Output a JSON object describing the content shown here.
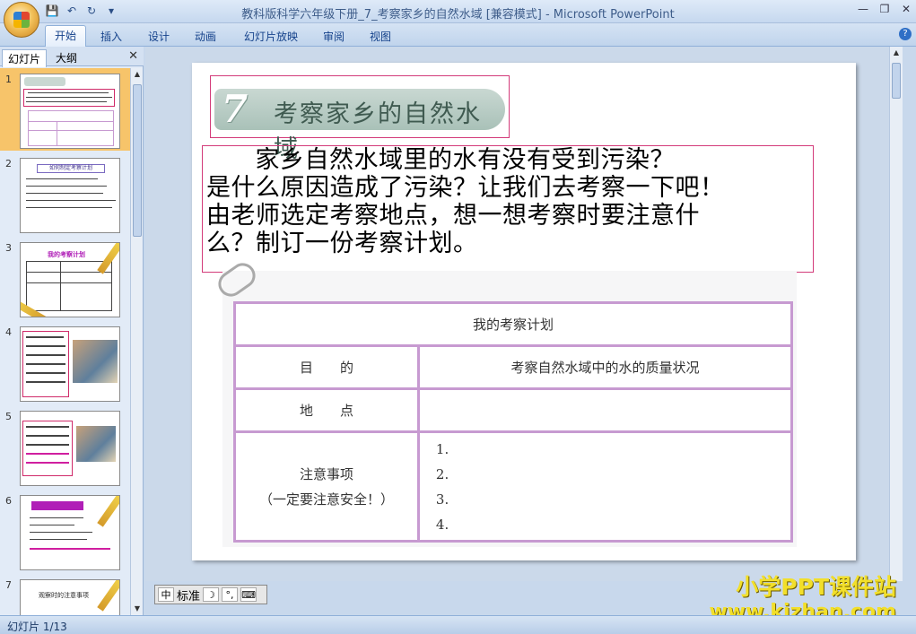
{
  "window": {
    "title": "教科版科学六年级下册_7_考察家乡的自然水域 [兼容模式] - Microsoft PowerPoint",
    "controls": [
      "—",
      "❐",
      "✕"
    ]
  },
  "quick_access": {
    "save_icon": "save-icon",
    "undo_icon": "undo-icon",
    "redo_icon": "redo-icon"
  },
  "ribbon": {
    "tabs": [
      "开始",
      "插入",
      "设计",
      "动画",
      "幻灯片放映",
      "审阅",
      "视图"
    ],
    "active_tab": "开始"
  },
  "left_pane": {
    "tabs": [
      "幻灯片",
      "大纲"
    ],
    "close": "✕",
    "thumbnails": [
      {
        "num": "1"
      },
      {
        "num": "2",
        "title": "如何制定考察计划"
      },
      {
        "num": "3",
        "title": "我的考察计划"
      },
      {
        "num": "4"
      },
      {
        "num": "5"
      },
      {
        "num": "6"
      },
      {
        "num": "7",
        "title": "观察时的注意事项"
      }
    ]
  },
  "slide": {
    "title_number": "7",
    "title": "考察家乡的自然水域",
    "body": "      家乡自然水域里的水有没有受到污染？\n是什么原因造成了污染？让我们去考察一下吧！\n由老师选定考察地点，想一想考察时要注意什\n么？制订一份考察计划。",
    "plan_table": {
      "header": "我的考察计划",
      "purpose_label": "目　　的",
      "purpose_value": "考察自然水域中的水的质量状况",
      "place_label": "地　　点",
      "place_value": "",
      "notes_label_1": "注意事项",
      "notes_label_2": "（一定要注意安全！）",
      "notes_items": [
        "1.",
        "2.",
        "3.",
        "4."
      ]
    }
  },
  "ime": {
    "label": "标准"
  },
  "watermark": {
    "line1": "小学PPT课件站",
    "line2": "www.kjzhan.com"
  },
  "status": {
    "slide_info": "幻灯片 1/13"
  }
}
